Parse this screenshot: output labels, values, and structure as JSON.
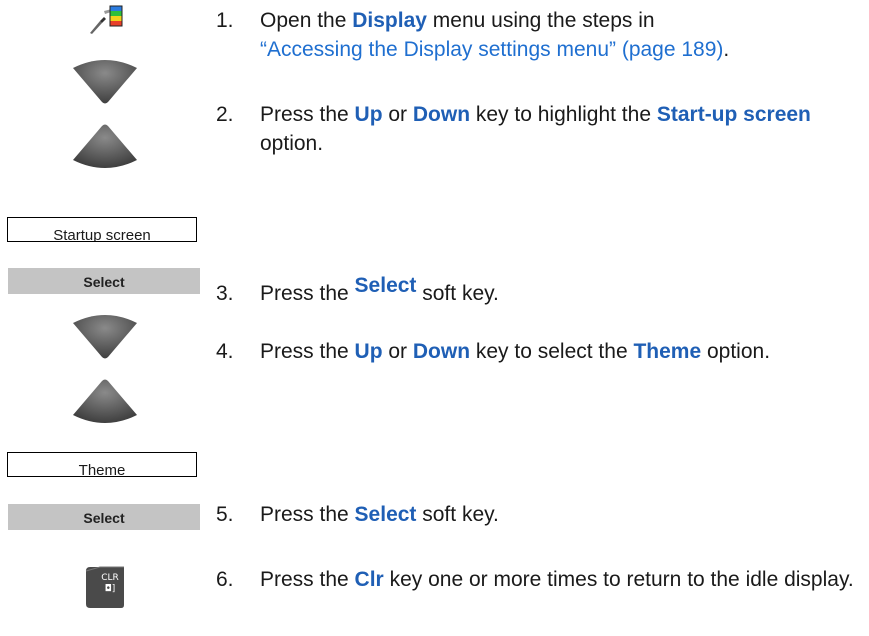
{
  "icons": {
    "display_menu": "display-settings-icon",
    "nav": "up-down-navigation-key-icon",
    "clr": "clr-key-icon"
  },
  "clr_key": {
    "line1": "CLR",
    "line2": "◘]"
  },
  "screens": {
    "startup": "Startup screen",
    "theme": "Theme"
  },
  "softkeys": {
    "select_1": "Select",
    "select_2": "Select"
  },
  "steps": [
    {
      "num": "1.",
      "pre": "Open the ",
      "kw1": "Display",
      "mid": " menu using the steps in",
      "link": "“Accessing the Display settings menu” (page 189)",
      "post": "."
    },
    {
      "num": "2.",
      "pre": "Press the ",
      "kw1": "Up",
      "mid": " or ",
      "kw2": "Down",
      "mid2": " key to highlight the ",
      "kw3": "Start-up screen",
      "post": " option."
    },
    {
      "num": "3.",
      "pre": "Press the ",
      "kw1": "Select",
      "post": " soft key."
    },
    {
      "num": "4.",
      "pre": "Press the ",
      "kw1": "Up",
      "mid": " or ",
      "kw2": "Down",
      "mid2": " key to select the ",
      "kw3": "Theme",
      "post": " option."
    },
    {
      "num": "5.",
      "pre": "Press the ",
      "kw1": "Select",
      "post": " soft key."
    },
    {
      "num": "6.",
      "pre": "Press the ",
      "kw1": "Clr",
      "post": " key one or more times to return to the idle display."
    }
  ],
  "colors": {
    "keyword": "#1f5fb5",
    "link": "#1f6fd0",
    "softkey_bg": "#c4c4c4"
  }
}
